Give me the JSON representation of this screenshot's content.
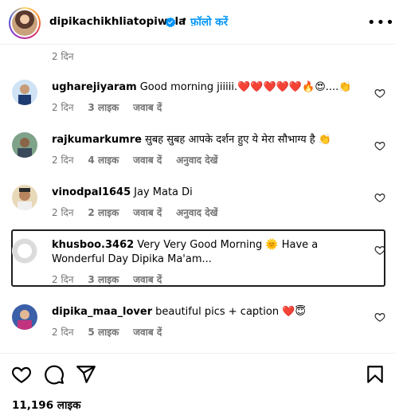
{
  "header": {
    "username": "dipikachikhliatopiwala",
    "separator": "•",
    "follow_label": "फ़ॉलो करें",
    "more_label": "•••"
  },
  "prev_comment_time": "2 दिन",
  "comments": [
    {
      "username": "ugharejiyaram",
      "text": "Good morning jiiiii.❤️❤️❤️❤️❤️🔥😍....👏",
      "time": "2 दिन",
      "likes": "3 लाइक",
      "reply": "जवाब दें",
      "translate": ""
    },
    {
      "username": "rajkumarkumre",
      "text": "सुबह सुबह आपके दर्शन हुए ये मेरा सौभाग्य है 👏",
      "time": "2 दिन",
      "likes": "4 लाइक",
      "reply": "जवाब दें",
      "translate": "अनुवाद देखें"
    },
    {
      "username": "vinodpal1645",
      "text": "Jay Mata Di",
      "time": "2 दिन",
      "likes": "2 लाइक",
      "reply": "जवाब दें",
      "translate": "अनुवाद देखें"
    },
    {
      "username": "khusboo.3462",
      "text": "Very Very Good Morning 🌞 Have a Wonderful Day Dipika Ma'am...",
      "time": "2 दिन",
      "likes": "3 लाइक",
      "reply": "जवाब दें",
      "translate": ""
    },
    {
      "username": "dipika_maa_lover",
      "text": "beautiful pics + caption ❤️😇",
      "time": "2 दिन",
      "likes": "5 लाइक",
      "reply": "जवाब दें",
      "translate": ""
    }
  ],
  "footer": {
    "likes_count": "11,196 लाइक"
  },
  "colors": {
    "link_blue": "#0095f6",
    "meta_gray": "#737373",
    "verified_blue": "#0095f6"
  },
  "icons": [
    "verified-badge-icon",
    "more-options-icon",
    "heart-icon",
    "comment-icon",
    "share-icon",
    "bookmark-icon"
  ]
}
